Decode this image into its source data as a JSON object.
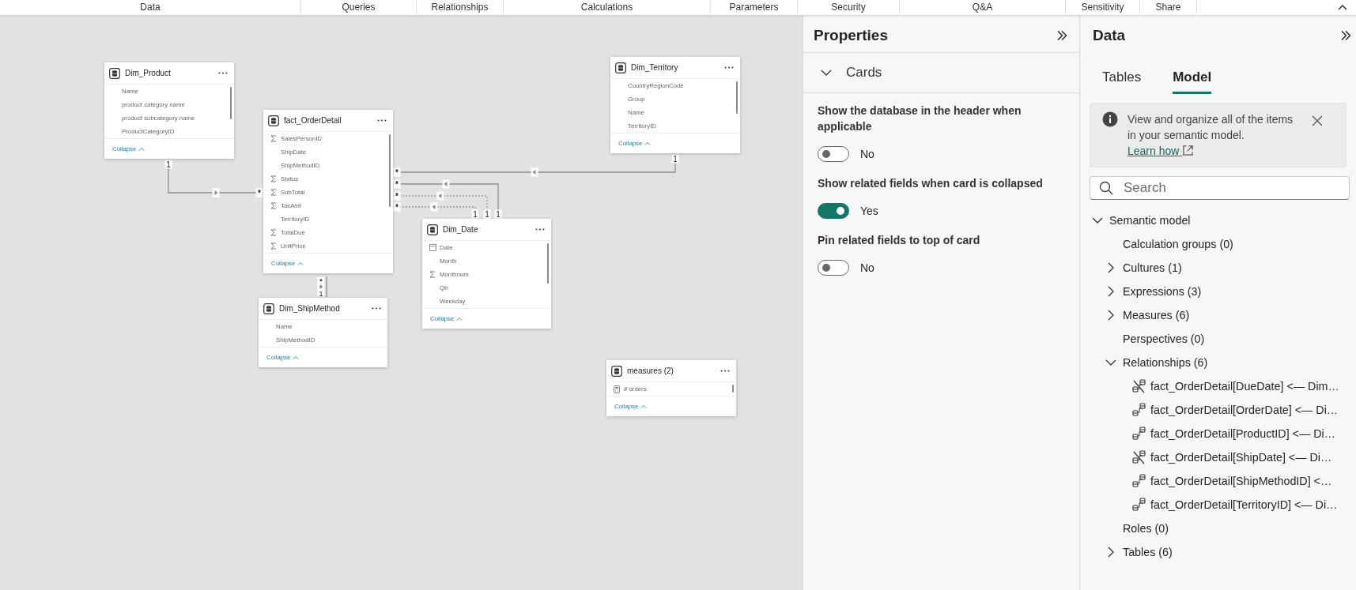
{
  "ribbon": {
    "groups": [
      "Data",
      "Queries",
      "Relationships",
      "Calculations",
      "Parameters",
      "Security",
      "Q&A",
      "Sensitivity",
      "Share"
    ]
  },
  "canvas": {
    "cards": [
      {
        "title": "Dim_Product",
        "scrollable": true,
        "fields": [
          {
            "name": "Name",
            "kind": "plain"
          },
          {
            "name": "product category name",
            "kind": "plain"
          },
          {
            "name": "product subcategory name",
            "kind": "plain"
          },
          {
            "name": "ProductCategoryID",
            "kind": "plain"
          }
        ],
        "footer": "Collapse"
      },
      {
        "title": "Dim_Territory",
        "scrollable": true,
        "fields": [
          {
            "name": "CountryRegionCode",
            "kind": "plain"
          },
          {
            "name": "Group",
            "kind": "plain"
          },
          {
            "name": "Name",
            "kind": "plain"
          },
          {
            "name": "TerritoryID",
            "kind": "plain"
          }
        ],
        "footer": "Collapse"
      },
      {
        "title": "fact_OrderDetail",
        "scrollable": true,
        "fields": [
          {
            "name": "SalesPersonID",
            "kind": "sum"
          },
          {
            "name": "ShipDate",
            "kind": "plain"
          },
          {
            "name": "ShipMethodID",
            "kind": "plain"
          },
          {
            "name": "Status",
            "kind": "sum"
          },
          {
            "name": "SubTotal",
            "kind": "sum"
          },
          {
            "name": "TaxAmt",
            "kind": "sum"
          },
          {
            "name": "TerritoryID",
            "kind": "plain"
          },
          {
            "name": "TotalDue",
            "kind": "sum"
          },
          {
            "name": "UnitPrice",
            "kind": "sum"
          }
        ],
        "footer": "Collapse"
      },
      {
        "title": "Dim_Date",
        "scrollable": true,
        "fields": [
          {
            "name": "Date",
            "kind": "date"
          },
          {
            "name": "Month",
            "kind": "plain"
          },
          {
            "name": "Monthnum",
            "kind": "sum"
          },
          {
            "name": "Qtr",
            "kind": "plain"
          },
          {
            "name": "Weekday",
            "kind": "plain"
          }
        ],
        "footer": "Collapse"
      },
      {
        "title": "Dim_ShipMethod",
        "scrollable": false,
        "fields": [
          {
            "name": "Name",
            "kind": "plain"
          },
          {
            "name": "ShipMethodID",
            "kind": "plain"
          }
        ],
        "footer": "Collapse"
      },
      {
        "title": "measures (2)",
        "scrollable": true,
        "fields": [
          {
            "name": "# orders",
            "kind": "measure"
          }
        ],
        "footer": "Collapse"
      }
    ],
    "relationships": [
      {
        "many_label": "*",
        "active": true
      },
      {
        "many_label": "*",
        "active": true
      },
      {
        "many_label": "*",
        "active": true
      },
      {
        "many_label": "*",
        "active": false
      },
      {
        "many_label": "*",
        "active": false
      },
      {
        "many_label": "*",
        "active": true
      }
    ],
    "one_end_labels": [
      "1",
      "1",
      "1",
      "1",
      "1",
      "1"
    ]
  },
  "properties": {
    "title": "Properties",
    "section": {
      "label": "Cards",
      "expanded": true
    },
    "settings": [
      {
        "label": "Show the database in the header when applicable",
        "on": false,
        "value": "No"
      },
      {
        "label": "Show related fields when card is collapsed",
        "on": true,
        "value": "Yes"
      },
      {
        "label": "Pin related fields to top of card",
        "on": false,
        "value": "No"
      }
    ]
  },
  "data_pane": {
    "title": "Data",
    "tabs": [
      {
        "label": "Tables",
        "selected": false
      },
      {
        "label": "Model",
        "selected": true
      }
    ],
    "banner": {
      "text": "View and organize all of the items in your semantic model.",
      "link": "Learn how"
    },
    "search": {
      "placeholder": "Search"
    },
    "tree": [
      {
        "label": "Semantic model",
        "expanded": true,
        "children": [
          {
            "label": "Calculation groups (0)"
          },
          {
            "label": "Cultures (1)",
            "expanded": false
          },
          {
            "label": "Expressions (3)",
            "expanded": false
          },
          {
            "label": "Measures (6)",
            "expanded": false
          },
          {
            "label": "Perspectives (0)"
          },
          {
            "label": "Relationships (6)",
            "expanded": true,
            "children": [
              {
                "label": "fact_OrderDetail[DueDate] <— Dim…",
                "kind": "relationship",
                "active": false
              },
              {
                "label": "fact_OrderDetail[OrderDate] <— Di…",
                "kind": "relationship",
                "active": true
              },
              {
                "label": "fact_OrderDetail[ProductID] <— Di…",
                "kind": "relationship",
                "active": true
              },
              {
                "label": "fact_OrderDetail[ShipDate] <— Di…",
                "kind": "relationship",
                "active": false
              },
              {
                "label": "fact_OrderDetail[ShipMethodID] <…",
                "kind": "relationship",
                "active": true
              },
              {
                "label": "fact_OrderDetail[TerritoryID] <— Di…",
                "kind": "relationship",
                "active": true
              }
            ]
          },
          {
            "label": "Roles (0)"
          },
          {
            "label": "Tables (6)",
            "expanded": false
          }
        ]
      }
    ]
  }
}
